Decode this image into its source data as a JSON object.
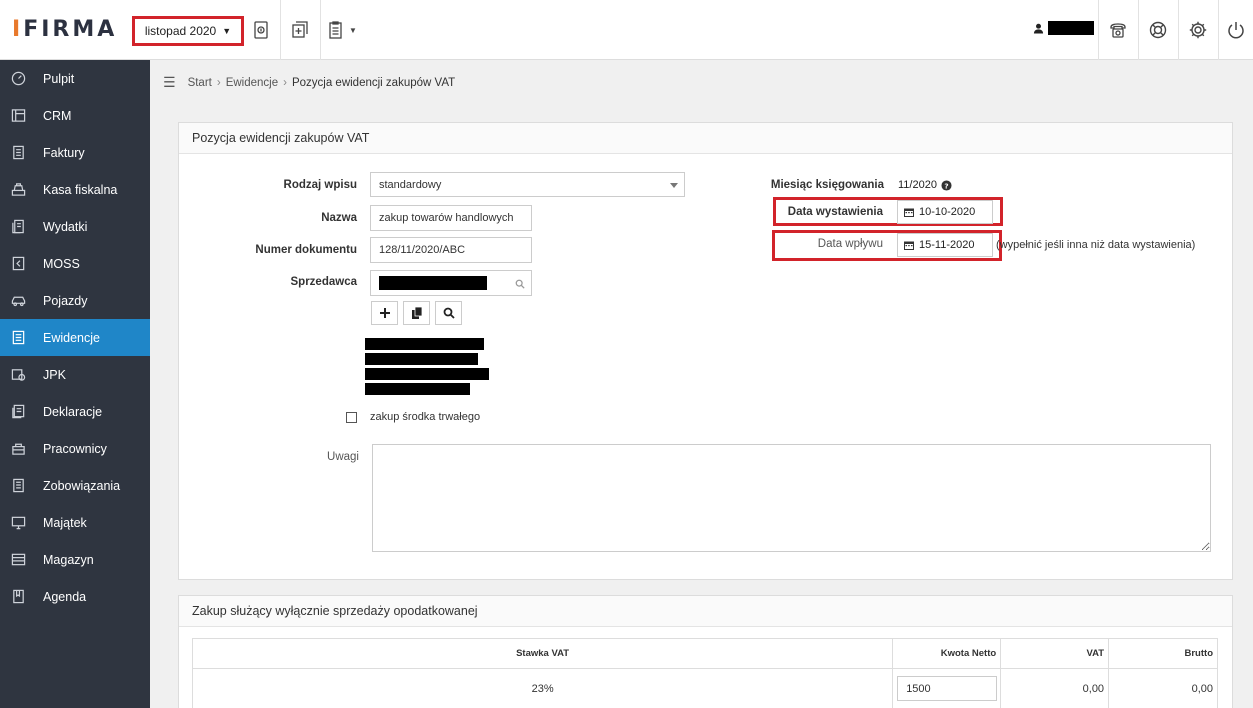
{
  "app": {
    "logo_prefix": "I",
    "logo_suffix": "FIRMA",
    "period": "listopad 2020"
  },
  "sidebar": {
    "items": [
      {
        "label": "Pulpit",
        "icon": "gauge-icon"
      },
      {
        "label": "CRM",
        "icon": "layout-icon"
      },
      {
        "label": "Faktury",
        "icon": "invoice-icon"
      },
      {
        "label": "Kasa fiskalna",
        "icon": "cash-register-icon"
      },
      {
        "label": "Wydatki",
        "icon": "expenses-icon"
      },
      {
        "label": "MOSS",
        "icon": "moss-icon"
      },
      {
        "label": "Pojazdy",
        "icon": "car-icon"
      },
      {
        "label": "Ewidencje",
        "icon": "ledger-icon"
      },
      {
        "label": "JPK",
        "icon": "jpk-icon"
      },
      {
        "label": "Deklaracje",
        "icon": "declaration-icon"
      },
      {
        "label": "Pracownicy",
        "icon": "employees-icon"
      },
      {
        "label": "Zobowiązania",
        "icon": "liabilities-icon"
      },
      {
        "label": "Majątek",
        "icon": "assets-icon"
      },
      {
        "label": "Magazyn",
        "icon": "warehouse-icon"
      },
      {
        "label": "Agenda",
        "icon": "agenda-icon"
      }
    ],
    "active_label": "Ewidencje"
  },
  "breadcrumb": {
    "start": "Start",
    "section": "Ewidencje",
    "current": "Pozycja ewidencji zakupów VAT"
  },
  "form": {
    "title": "Pozycja ewidencji zakupów VAT",
    "rodzaj_label": "Rodzaj wpisu",
    "rodzaj_value": "standardowy",
    "nazwa_label": "Nazwa",
    "nazwa_value": "zakup towarów handlowych",
    "numer_label": "Numer dokumentu",
    "numer_value": "128/11/2020/ABC",
    "sprzedawca_label": "Sprzedawca",
    "miesiac_label": "Miesiąc księgowania",
    "miesiac_value": "11/2020",
    "data_wyst_label": "Data wystawienia",
    "data_wyst_value": "10-10-2020",
    "data_wplywu_label": "Data wpływu",
    "data_wplywu_value": "15-11-2020",
    "data_wplywu_hint": "(wypełnić jeśli inna niż data wystawienia)",
    "srodek_label": "zakup środka trwałego",
    "uwagi_label": "Uwagi"
  },
  "vat_section": {
    "title": "Zakup służący wyłącznie sprzedaży opodatkowanej",
    "headers": {
      "stawka": "Stawka VAT",
      "netto": "Kwota Netto",
      "vat": "VAT",
      "brutto": "Brutto"
    },
    "row": {
      "stawka": "23%",
      "netto": "1500",
      "vat": "0,00",
      "brutto": "0,00"
    }
  }
}
